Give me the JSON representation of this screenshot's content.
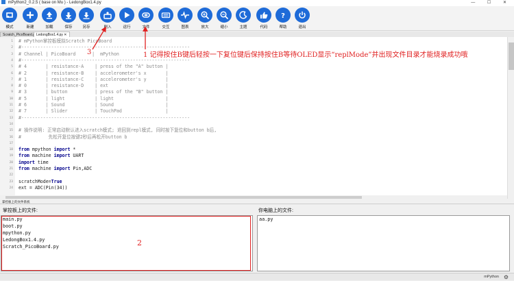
{
  "window": {
    "title": "mPython2_0.2.5 ( base on Mu ) - LedongBox1.4.py",
    "controls": "— ☐ ✕"
  },
  "toolbar": {
    "buttons": [
      {
        "label": "模式",
        "icon": "mode-icon"
      },
      {
        "label": "新建",
        "icon": "plus-icon"
      },
      {
        "label": "加载",
        "icon": "upload-icon"
      },
      {
        "label": "保存",
        "icon": "download-icon"
      },
      {
        "label": "另存",
        "icon": "save-as-icon"
      },
      {
        "label": "刷入",
        "icon": "flash-icon"
      },
      {
        "label": "运行",
        "icon": "play-icon"
      },
      {
        "label": "文件",
        "icon": "files-icon"
      },
      {
        "label": "交互",
        "icon": "keyboard-icon"
      },
      {
        "label": "图表",
        "icon": "pulse-icon"
      },
      {
        "label": "放大",
        "icon": "zoom-in-icon"
      },
      {
        "label": "缩小",
        "icon": "zoom-out-icon"
      },
      {
        "label": "主题",
        "icon": "moon-icon"
      },
      {
        "label": "代码",
        "icon": "thumbs-up-icon"
      },
      {
        "label": "帮助",
        "icon": "help-icon"
      },
      {
        "label": "退出",
        "icon": "power-icon"
      }
    ]
  },
  "tabs": [
    {
      "label": "Scratch_PicoBoard.py"
    },
    {
      "label": "LedongBox1.4.py"
    }
  ],
  "editor": {
    "lines": [
      {
        "n": "1",
        "t": "# mPython掌控板模拟Scratch PicoBoard",
        "cls": "c"
      },
      {
        "n": "2",
        "t": "#--------------------------------------------------------------",
        "cls": "c"
      },
      {
        "n": "3",
        "t": "# Channel | PicoBoard      |  mPython",
        "cls": "c"
      },
      {
        "n": "4",
        "t": "#--------------------------------------------------------------",
        "cls": "c"
      },
      {
        "n": "5",
        "t": "# 4       | resistance-A    | press of the \"A\" button |",
        "cls": "c"
      },
      {
        "n": "6",
        "t": "# 2       | resistance-B    | accelerometer's x       |",
        "cls": "c"
      },
      {
        "n": "7",
        "t": "# 1       | resistance-C    | accelerometer's y       |",
        "cls": "c"
      },
      {
        "n": "8",
        "t": "# 0       | resistance-D    | ext                     |",
        "cls": "c"
      },
      {
        "n": "9",
        "t": "# 3       | button          | press of the \"B\" button |",
        "cls": "c"
      },
      {
        "n": "10",
        "t": "# 5       | light           | light                   |",
        "cls": "c"
      },
      {
        "n": "11",
        "t": "# 6       | Sound           | Sound                   |",
        "cls": "c"
      },
      {
        "n": "12",
        "t": "# 7       | Slider          | TouchPad                |",
        "cls": "c"
      },
      {
        "n": "13",
        "t": "#--------------------------------------------------------------",
        "cls": "c"
      },
      {
        "n": "14",
        "t": "",
        "cls": "n"
      },
      {
        "n": "15",
        "t": "# 操作说明: 正常启动默认进入scratch模式; 退回到repl模式, 同时按下复位和button b后,",
        "cls": "c"
      },
      {
        "n": "16",
        "t": "#          先松开复位按键2秒后再松开button b",
        "cls": "c"
      },
      {
        "n": "17",
        "t": "",
        "cls": "n"
      },
      {
        "n": "18",
        "k": "from",
        "t1": " mpython ",
        "k2": "import",
        "t2": " *"
      },
      {
        "n": "19",
        "k": "from",
        "t1": " machine ",
        "k2": "import",
        "t2": " UART"
      },
      {
        "n": "20",
        "k": "import",
        "t1": " time",
        "k2": "",
        "t2": ""
      },
      {
        "n": "21",
        "k": "from",
        "t1": " machine ",
        "k2": "import",
        "t2": " Pin,ADC"
      },
      {
        "n": "22",
        "t": "",
        "cls": "n"
      },
      {
        "n": "23",
        "t": "scratchMode=",
        "k3": "True"
      },
      {
        "n": "24",
        "t": "ext = ADC(Pin(34))",
        "cls": "n"
      }
    ]
  },
  "filepanel": {
    "title": "掌控板上的文件系统",
    "board_label": "掌控板上的文件:",
    "pc_label": "你电脑上的文件:",
    "board_files": [
      "main.py",
      "boot.py",
      "mpython.py",
      "LedongBox1.4.py",
      "Scratch_PicoBoard.py"
    ],
    "pc_files": [
      "aa.py"
    ]
  },
  "annotations": {
    "a1": "1 记得按住B键后轻按一下复位键后保持按住B等待OLED显示“replMode”并出现文件目录才能烧录成功哦",
    "a2": "2",
    "a3": "3"
  },
  "status": {
    "mode": "mPython"
  },
  "colors": {
    "accent": "#1e6bd8",
    "annotation": "#e02020"
  }
}
